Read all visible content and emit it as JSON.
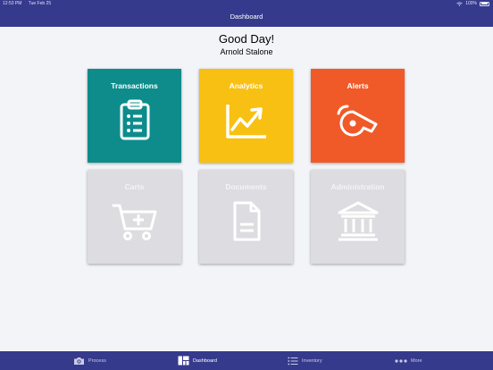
{
  "status_bar": {
    "time": "12:53 PM",
    "date": "Tue Feb 25",
    "battery": "100%"
  },
  "header": {
    "title": "Dashboard"
  },
  "greeting": {
    "message": "Good Day!",
    "user_name": "Arnold Stalone"
  },
  "tiles": [
    {
      "label": "Transactions",
      "icon": "clipboard-icon",
      "color": "#0e8c8c",
      "enabled": true
    },
    {
      "label": "Analytics",
      "icon": "trending-chart-icon",
      "color": "#f8c013",
      "enabled": true
    },
    {
      "label": "Alerts",
      "icon": "whistle-icon",
      "color": "#f05a28",
      "enabled": true
    },
    {
      "label": "Carts",
      "icon": "cart-plus-icon",
      "color": "#dcdce1",
      "enabled": false
    },
    {
      "label": "Documents",
      "icon": "document-icon",
      "color": "#dcdce1",
      "enabled": false
    },
    {
      "label": "Administration",
      "icon": "bank-building-icon",
      "color": "#dcdce1",
      "enabled": false
    }
  ],
  "tab_bar": [
    {
      "label": "Process",
      "icon": "camera-icon",
      "active": false
    },
    {
      "label": "Dashboard",
      "icon": "dashboard-icon",
      "active": true
    },
    {
      "label": "Inventory",
      "icon": "list-icon",
      "active": false
    },
    {
      "label": "More",
      "icon": "more-dots-icon",
      "active": false
    }
  ],
  "colors": {
    "primary": "#363a8c",
    "background": "#f3f4f8",
    "disabled_tile": "#dcdce1"
  }
}
